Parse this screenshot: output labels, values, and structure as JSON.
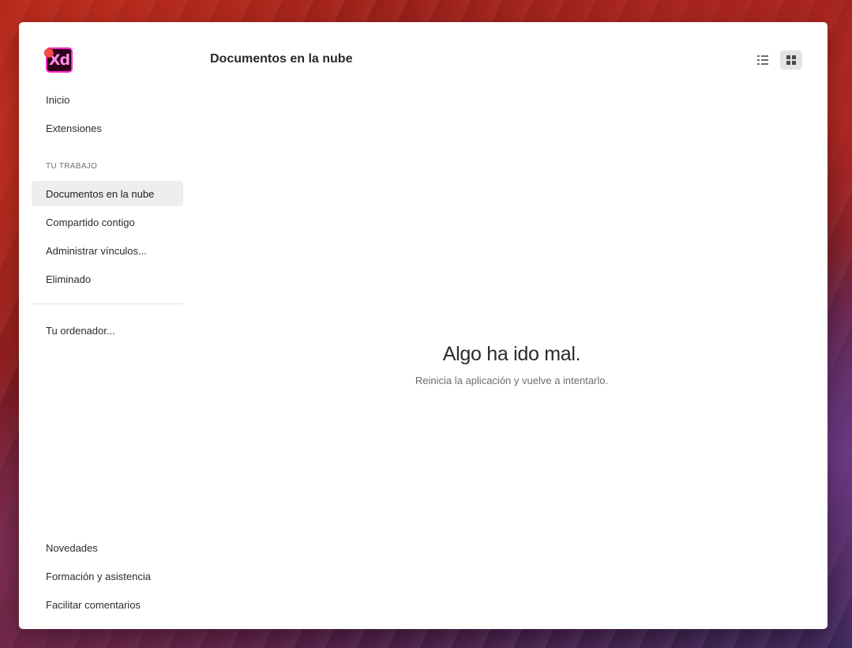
{
  "app": {
    "logo_text": "Xd",
    "brand_color": "#ff2bc2"
  },
  "sidebar": {
    "top_items": [
      {
        "label": "Inicio"
      },
      {
        "label": "Extensiones"
      }
    ],
    "section_label": "TU TRABAJO",
    "work_items": [
      {
        "label": "Documentos en la nube",
        "active": true
      },
      {
        "label": "Compartido contigo"
      },
      {
        "label": "Administrar vínculos..."
      },
      {
        "label": "Eliminado"
      }
    ],
    "local_items": [
      {
        "label": "Tu ordenador..."
      }
    ],
    "bottom_items": [
      {
        "label": "Novedades"
      },
      {
        "label": "Formación y asistencia"
      },
      {
        "label": "Facilitar comentarios"
      }
    ]
  },
  "header": {
    "title": "Documentos en la nube",
    "view_list_icon": "list-view-icon",
    "view_grid_icon": "grid-view-icon",
    "selected_view": "grid"
  },
  "main": {
    "error_title": "Algo ha ido mal.",
    "error_message": "Reinicia la aplicación y vuelve a intentarlo."
  }
}
